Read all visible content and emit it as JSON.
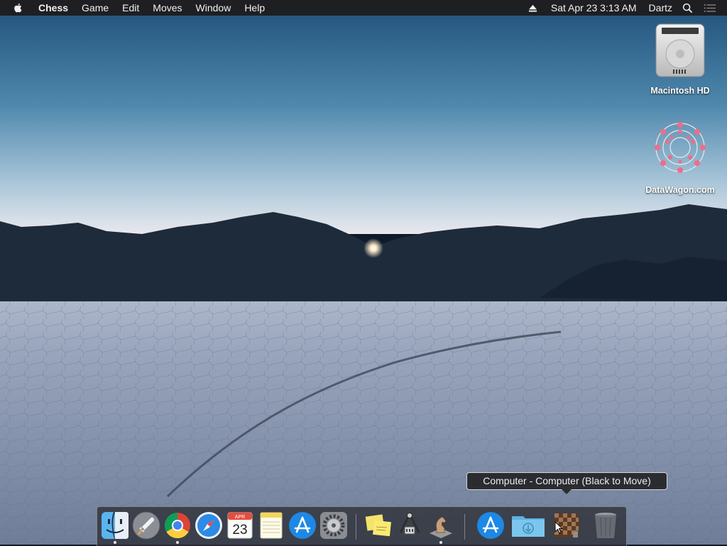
{
  "menubar": {
    "apple_icon": "apple-icon",
    "app_name": "Chess",
    "menus": [
      "Game",
      "Edit",
      "Moves",
      "Window",
      "Help"
    ],
    "clock": "Sat Apr 23  3:13 AM",
    "user": "Dartz"
  },
  "desktop": {
    "icons": [
      {
        "label": "Macintosh HD",
        "icon": "hard-drive-icon"
      },
      {
        "label": "DataWagon.com",
        "icon": "datawagon-icon"
      }
    ]
  },
  "tooltip": "Computer - Computer   (Black to Move)",
  "dock": {
    "items": [
      {
        "name": "finder",
        "running": true
      },
      {
        "name": "launchpad",
        "running": false
      },
      {
        "name": "chrome",
        "running": true
      },
      {
        "name": "safari",
        "running": false
      },
      {
        "name": "calendar",
        "running": false,
        "month": "APR",
        "day": "23"
      },
      {
        "name": "notes",
        "running": false
      },
      {
        "name": "app-store",
        "running": false
      },
      {
        "name": "system-preferences",
        "running": false
      },
      {
        "name": "stickies",
        "running": false
      },
      {
        "name": "directory-utility",
        "running": false
      },
      {
        "name": "chess",
        "running": true
      },
      {
        "name": "app-store-downloads",
        "running": false
      },
      {
        "name": "downloads-folder",
        "running": false
      },
      {
        "name": "chess-window",
        "running": false
      },
      {
        "name": "trash",
        "running": false
      }
    ]
  },
  "colors": {
    "menubar_bg": "#1e1f22",
    "sky_top": "#1f4f78",
    "sky_horizon": "#e9e8ee",
    "mountains": "#1d2b3b",
    "playa": "#8d9ab3"
  }
}
